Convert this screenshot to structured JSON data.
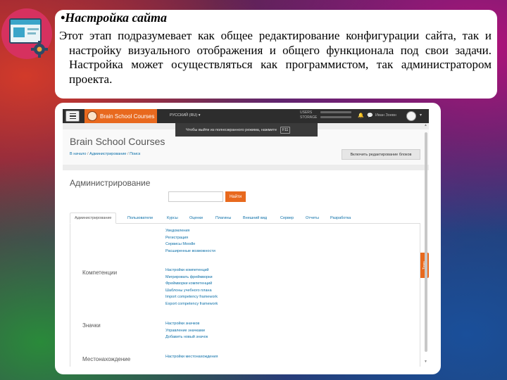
{
  "slide": {
    "heading": "•Настройка сайта",
    "paragraph": "Этот этап подразумевает как общее редактирование конфигурации сайта, так и настройку визуального отображения и общего функционала под свои задачи. Настройка может осуществляться как программистом, так администратором проекта."
  },
  "moodle": {
    "navbar": {
      "brand": "Brain School Courses",
      "language": "РУССКИЙ (RU) ▾",
      "users_label": "USERS",
      "storage_label": "STORAGE",
      "username": "Иван Зоевн"
    },
    "fullscreen_tip": "Чтобы выйти из полноэкранного режима, нажмите",
    "fullscreen_key": "F11",
    "course_title": "Brain School Courses",
    "breadcrumb": [
      "В начало",
      "Администрирование",
      "Поиск"
    ],
    "edit_blocks_button": "Включить редактирование блоков",
    "admin_title": "Администрирование",
    "search_button": "Найти",
    "tabs": [
      "Администрирование",
      "Пользователи",
      "Курсы",
      "Оценки",
      "Плагины",
      "Внешний вид",
      "Сервер",
      "Отчеты",
      "Разработка"
    ],
    "top_links": [
      "Уведомления",
      "Регистрация",
      "Сервисы Moodle",
      "Расширенные возможности"
    ],
    "sections": [
      {
        "title": "Компетенции",
        "links": [
          "Настройки компетенций",
          "Мигрировать фреймворки",
          "Фреймворки компетенций",
          "Шаблоны учебного плана",
          "Import competency framework",
          "Export competency framework"
        ]
      },
      {
        "title": "Значки",
        "links": [
          "Настройки значков",
          "Управление значками",
          "Добавить новый значок"
        ]
      },
      {
        "title": "Местонахождение",
        "links": [
          "Настройки местонахождения"
        ]
      }
    ],
    "side_tab": "Тема"
  }
}
